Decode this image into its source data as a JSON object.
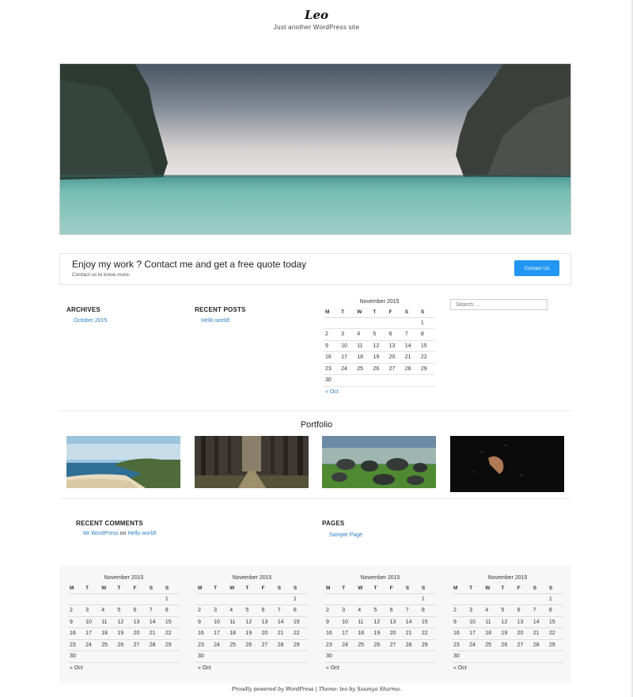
{
  "site": {
    "title": "Leo",
    "description": "Just another WordPress site"
  },
  "cta": {
    "title": "Enjoy my work ? Contact me and get a free quote today",
    "subtitle": "Contact us to know more.",
    "button": "Contact Us",
    "button_color": "#2196f3"
  },
  "archives": {
    "title": "ARCHIVES",
    "items": [
      "October 2015"
    ]
  },
  "recent_posts": {
    "title": "RECENT POSTS",
    "items": [
      "Hello world!"
    ]
  },
  "search": {
    "placeholder": "Search ..."
  },
  "calendar": {
    "caption": "November 2015",
    "days": [
      "M",
      "T",
      "W",
      "T",
      "F",
      "S",
      "S"
    ],
    "weeks": [
      [
        "",
        "",
        "",
        "",
        "",
        "",
        "1"
      ],
      [
        "2",
        "3",
        "4",
        "5",
        "6",
        "7",
        "8"
      ],
      [
        "9",
        "10",
        "11",
        "12",
        "13",
        "14",
        "15"
      ],
      [
        "16",
        "17",
        "18",
        "19",
        "20",
        "21",
        "22"
      ],
      [
        "23",
        "24",
        "25",
        "26",
        "27",
        "28",
        "29"
      ],
      [
        "30",
        "",
        "",
        "",
        "",
        "",
        ""
      ]
    ],
    "prev": "« Oct"
  },
  "portfolio": {
    "title": "Portfolio",
    "items": [
      "coastline-photo",
      "forest-path-photo",
      "stones-on-grass-photo",
      "dark-hand-photo"
    ]
  },
  "recent_comments": {
    "title": "RECENT COMMENTS",
    "author": "Mr WordPress",
    "on": "on",
    "post": "Hello world!"
  },
  "pages": {
    "title": "PAGES",
    "items": [
      "Sample Page"
    ]
  },
  "footer": {
    "credits": "Proudly powered by WordPress | Theme: leo by Saumya Sharma."
  },
  "colors": {
    "link": "#2a7fc6",
    "accent": "#2196f3"
  }
}
